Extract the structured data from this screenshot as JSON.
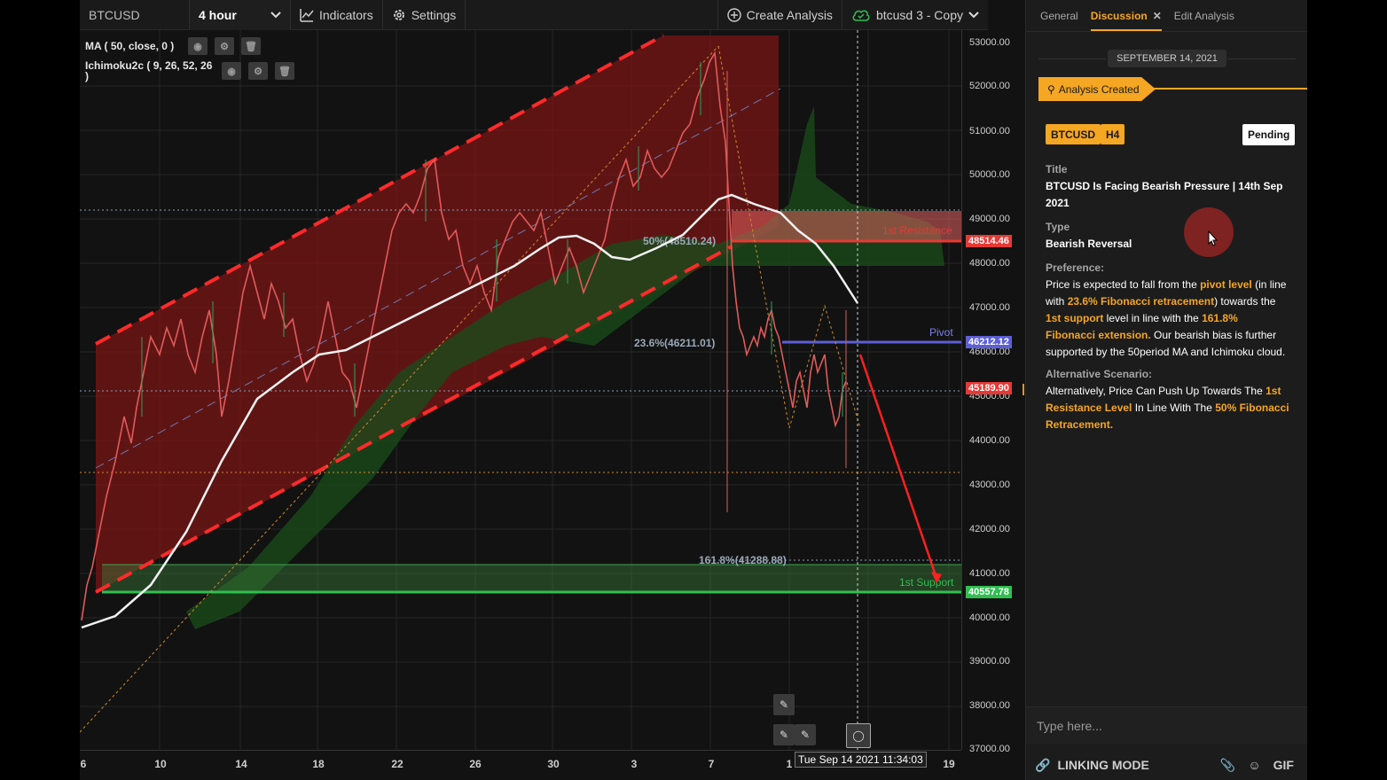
{
  "toolbar": {
    "symbol": "BTCUSD",
    "interval": "4 hour",
    "indicators_label": "Indicators",
    "settings_label": "Settings",
    "create_analysis_label": "Create Analysis",
    "layout_name": "btcusd 3 - Copy"
  },
  "legend": {
    "ma": "MA ( 50, close, 0 )",
    "ichimoku": "Ichimoku2c ( 9, 26, 52, 26 )"
  },
  "chart": {
    "price_ticks": [
      "53000.00",
      "52000.00",
      "51000.00",
      "50000.00",
      "49000.00",
      "48000.00",
      "47000.00",
      "46000.00",
      "45000.00",
      "44000.00",
      "43000.00",
      "42000.00",
      "41000.00",
      "40000.00",
      "39000.00",
      "38000.00",
      "37000.00"
    ],
    "time_ticks": [
      "6",
      "10",
      "14",
      "18",
      "22",
      "26",
      "30",
      "3",
      "7",
      "1",
      "19"
    ],
    "crosshair_time": "Tue Sep 14 2021 11:34:03",
    "labels": {
      "resistance": "1st Resistance",
      "pivot": "Pivot",
      "support": "1st Support",
      "fib50": "50%(48510.24)",
      "fib236": "23.6%(46211.01)",
      "fib1618": "161.8%(41288.88)"
    },
    "tags": {
      "resistance_price": "48514.46",
      "pivot_price": "46212.12",
      "current_price": "45189.90",
      "support_price": "40557.78"
    },
    "colors": {
      "resistance": "#e53935",
      "pivot": "#5c5fd6",
      "support": "#2fbf4f",
      "accent": "#f5a623"
    }
  },
  "panel": {
    "tabs": [
      "General",
      "Discussion",
      "Edit Analysis"
    ],
    "date": "SEPTEMBER 14, 2021",
    "created": "Analysis Created",
    "symbol_tag": "BTCUSD",
    "timeframe_tag": "H4",
    "status": "Pending",
    "title_label": "Title",
    "title_value": "BTCUSD Is Facing Bearish Pressure | 14th Sep 2021",
    "type_label": "Type",
    "type_value": "Bearish Reversal",
    "preference_label": "Preference:",
    "preference": {
      "p1": "Price is expected to fall from the ",
      "h1": "pivot level",
      "p2": " (in line with ",
      "h2": "23.6% Fibonacci retracement",
      "p3": ") towards the ",
      "h3": "1st support",
      "p4": " level in line with the ",
      "h4": "161.8% Fibonacci extension.",
      "p5": " Our bearish bias is further supported by the 50period MA and Ichimoku cloud."
    },
    "alternative_label": "Alternative Scenario:",
    "alternative": {
      "p1": "Alternatively, Price Can Push Up Towards The ",
      "h1": "1st Resistance Level",
      "p2": " In Line With The ",
      "h2": "50% Fibonacci Retracement."
    },
    "comment_placeholder": "Type here...",
    "linking_mode": "LINKING MODE",
    "gif_label": "GIF"
  }
}
